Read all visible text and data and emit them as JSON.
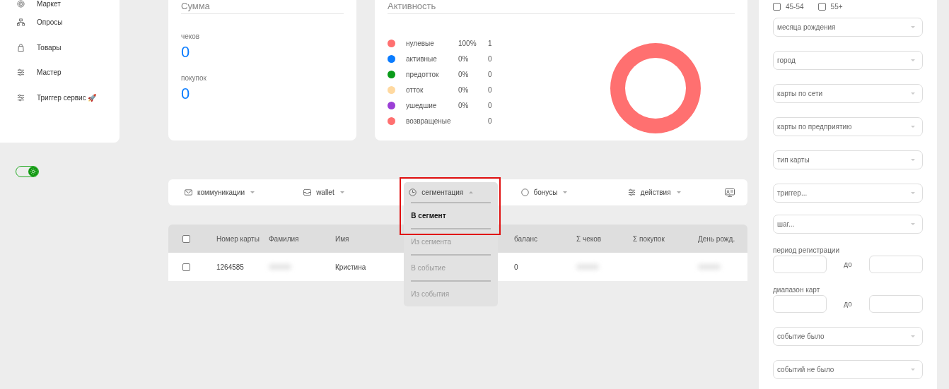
{
  "sidebar": {
    "items": [
      {
        "label": "Маркет"
      },
      {
        "label": "Опросы"
      },
      {
        "label": "Товары"
      },
      {
        "label": "Мастер"
      },
      {
        "label": "Триггер сервис 🚀"
      }
    ]
  },
  "theme_toggle": {
    "on": true
  },
  "sum_card": {
    "title": "Сумма",
    "stats": [
      {
        "label": "чеков",
        "value": "0"
      },
      {
        "label": "покупок",
        "value": "0"
      }
    ]
  },
  "activity_card": {
    "title": "Активность",
    "legend": [
      {
        "percent": "100%",
        "count": "1",
        "color": "#ff7070"
      },
      {
        "percent": "0%",
        "count": "0",
        "color": "#0a7cff"
      },
      {
        "percent": "0%",
        "count": "0",
        "color": "#0a9b1a"
      },
      {
        "percent": "0%",
        "count": "0",
        "color": "#ffd9a0"
      },
      {
        "percent": "0%",
        "count": "0",
        "color": "#9b3fd6"
      },
      {
        "count": "0",
        "color": "#ff7070"
      }
    ],
    "chart_data": {
      "type": "donut",
      "categories": [
        "нулевые",
        "активные",
        "предотток",
        "отток",
        "ушедшие",
        "возвращеные"
      ],
      "values": [
        1,
        0,
        0,
        0,
        0,
        0
      ]
    }
  },
  "toolbar": {
    "items": [
      {
        "label": "коммуникации",
        "expanded": false
      },
      {
        "label": "wallet",
        "expanded": false
      },
      {
        "label": "сегментация",
        "expanded": true,
        "menu": [
          {
            "label": "В сегмент",
            "selected": true
          },
          {
            "label": "Из сегмента",
            "selected": false
          },
          {
            "label": "В событие",
            "selected": false
          },
          {
            "label": "Из события",
            "selected": false
          }
        ]
      },
      {
        "label": "бонусы",
        "expanded": false
      },
      {
        "label": "действия",
        "expanded": false
      }
    ]
  },
  "table": {
    "columns": [
      "Номер карты",
      "Фамилия",
      "Имя",
      "",
      "баланс",
      "Σ чеков",
      "Σ покупок",
      "День рожд."
    ],
    "rows": [
      {
        "checked": false,
        "cells": [
          {
            "text": "1264585"
          },
          {
            "blurred": true
          },
          {
            "text": "Кристина"
          },
          {},
          {
            "text": "0"
          },
          {
            "blurred": true
          },
          {},
          {
            "blurred": true
          }
        ]
      }
    ],
    "header_checked": false
  },
  "filters": {
    "age_checkboxes": [
      {
        "label": "45-54",
        "checked": false
      },
      {
        "label": "55+",
        "checked": false
      }
    ],
    "fields": [
      {
        "kind": "select",
        "placeholder": "месяца рождения"
      },
      {
        "kind": "select",
        "placeholder": "город"
      },
      {
        "kind": "select",
        "placeholder": "карты по сети"
      },
      {
        "kind": "select",
        "placeholder": "карты по предприятию"
      },
      {
        "kind": "select",
        "placeholder": "тип карты"
      },
      {
        "kind": "select",
        "placeholder": "триггер..."
      },
      {
        "kind": "select",
        "placeholder": "шаг..."
      },
      {
        "kind": "range",
        "label": "период регистрации",
        "separator": "до"
      },
      {
        "kind": "range",
        "label": "диапазон карт",
        "separator": "до"
      },
      {
        "kind": "select",
        "placeholder": "событие было"
      },
      {
        "kind": "select",
        "placeholder": "событий не было"
      }
    ]
  }
}
